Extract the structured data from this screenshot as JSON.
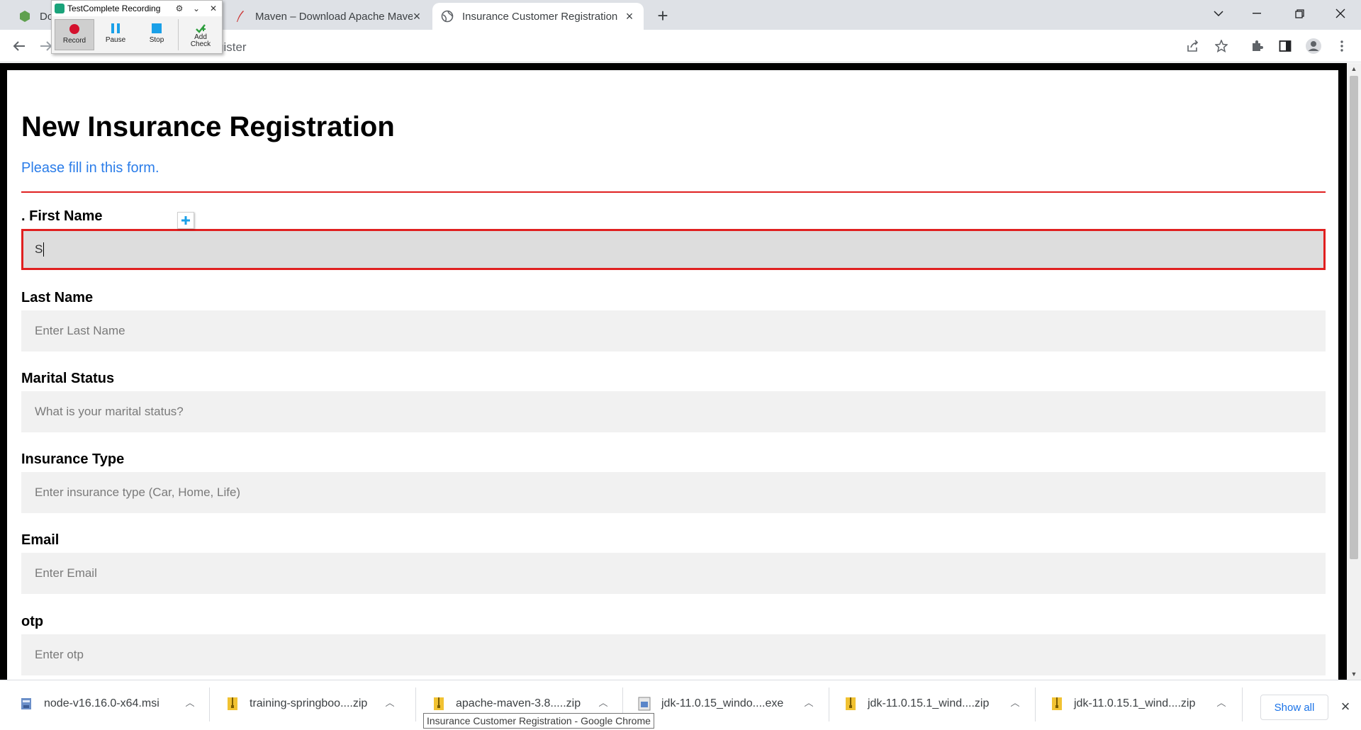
{
  "tabs": [
    {
      "title": "Dc",
      "favicon": "node-icon",
      "active": false
    },
    {
      "title": "Maven – Download Apache Mave",
      "favicon": "maven-feather-icon",
      "active": false
    },
    {
      "title": "Insurance Customer Registration",
      "favicon": "globe-icon",
      "active": true
    }
  ],
  "toolbar": {
    "url_partial": "gister"
  },
  "testcomplete": {
    "title": "TestComplete Recording",
    "buttons": [
      {
        "label": "Record"
      },
      {
        "label": "Pause"
      },
      {
        "label": "Stop"
      },
      {
        "label": "Add Check"
      }
    ]
  },
  "form": {
    "title": "New Insurance Registration",
    "subtitle": "Please fill in this form.",
    "fields": [
      {
        "label": ". First Name",
        "value": "S",
        "placeholder": ""
      },
      {
        "label": "Last Name",
        "value": "",
        "placeholder": "Enter Last Name"
      },
      {
        "label": "Marital Status",
        "value": "",
        "placeholder": "What is your marital status?"
      },
      {
        "label": "Insurance Type",
        "value": "",
        "placeholder": "Enter insurance type (Car, Home, Life)"
      },
      {
        "label": "Email",
        "value": "",
        "placeholder": "Enter Email"
      },
      {
        "label": "otp",
        "value": "",
        "placeholder": "Enter otp"
      }
    ]
  },
  "downloads": {
    "items": [
      {
        "name": "node-v16.16.0-x64.msi",
        "icon": "msi-installer-icon"
      },
      {
        "name": "training-springboo....zip",
        "icon": "zip-archive-icon"
      },
      {
        "name": "apache-maven-3.8.....zip",
        "icon": "zip-archive-icon"
      },
      {
        "name": "jdk-11.0.15_windo....exe",
        "icon": "exe-file-icon"
      },
      {
        "name": "jdk-11.0.15.1_wind....zip",
        "icon": "zip-archive-icon"
      },
      {
        "name": "jdk-11.0.15.1_wind....zip",
        "icon": "zip-archive-icon"
      }
    ],
    "show_all_label": "Show all",
    "tooltip": "Insurance Customer Registration - Google Chrome"
  },
  "colors": {
    "accent_red": "#e02020",
    "subtitle_blue": "#2b7de9",
    "record_red": "#d4112d",
    "tc_blue": "#1aa0e8"
  }
}
